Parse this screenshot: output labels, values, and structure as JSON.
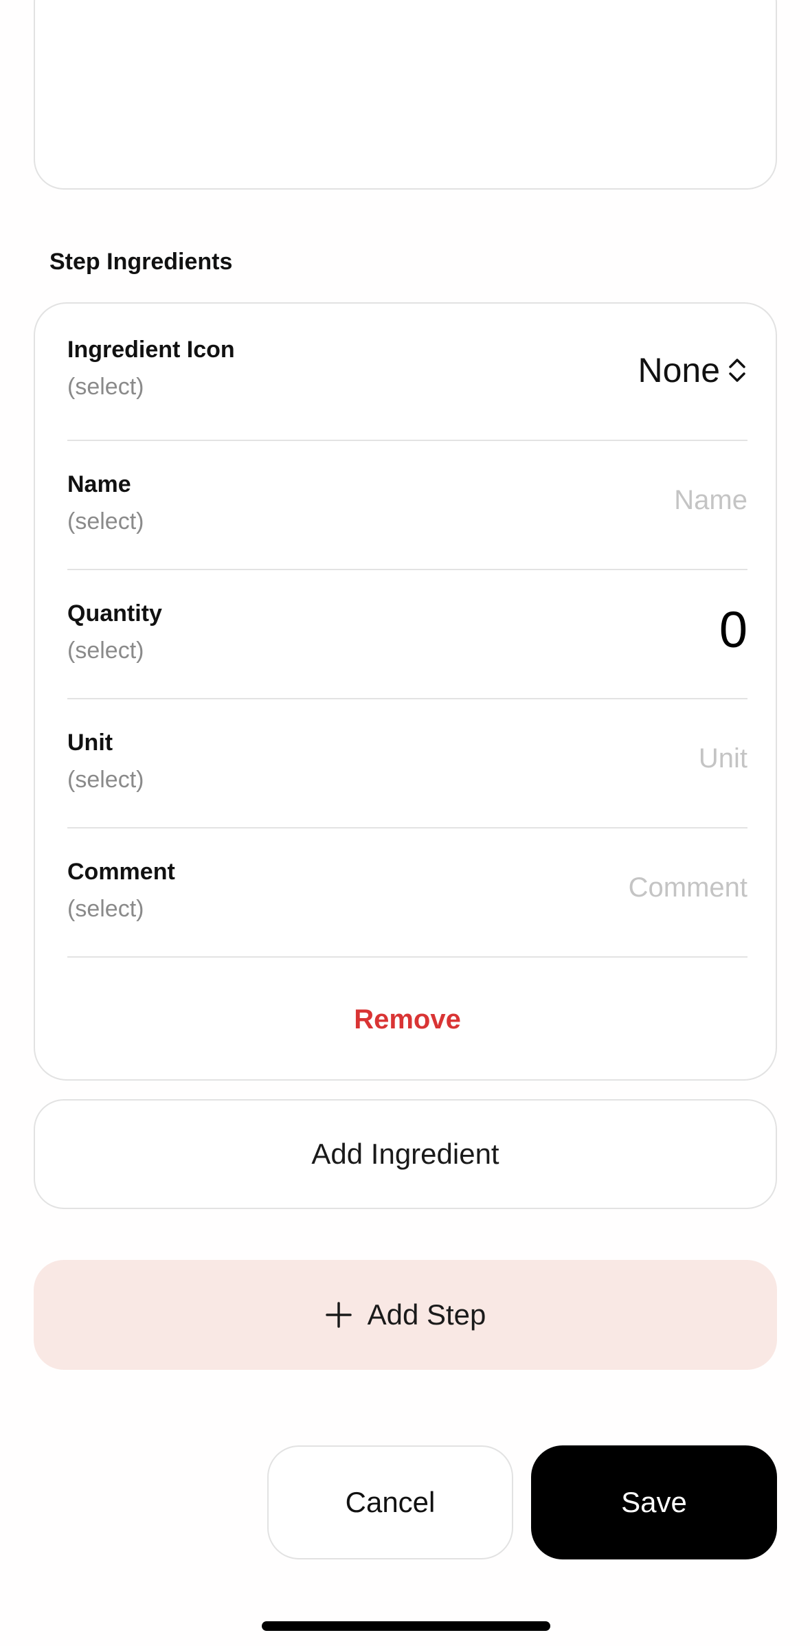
{
  "section": {
    "title": "Step Ingredients"
  },
  "ingredient": {
    "icon_label": "Ingredient Icon",
    "icon_sub": "(select)",
    "icon_value": "None",
    "name_label": "Name",
    "name_sub": "(select)",
    "name_placeholder": "Name",
    "quantity_label": "Quantity",
    "quantity_sub": "(select)",
    "quantity_value": "0",
    "unit_label": "Unit",
    "unit_sub": "(select)",
    "unit_placeholder": "Unit",
    "comment_label": "Comment",
    "comment_sub": "(select)",
    "comment_placeholder": "Comment",
    "remove_label": "Remove"
  },
  "actions": {
    "add_ingredient_label": "Add Ingredient",
    "add_step_label": "Add Step",
    "cancel_label": "Cancel",
    "save_label": "Save"
  },
  "icons": {
    "select_chevrons": "chevron-up-down-icon",
    "add_step": "plus-icon"
  },
  "colors": {
    "remove": "#d93434",
    "add_step_bg": "#f9e8e4",
    "save_bg": "#000000",
    "placeholder": "#c4c4c4"
  }
}
